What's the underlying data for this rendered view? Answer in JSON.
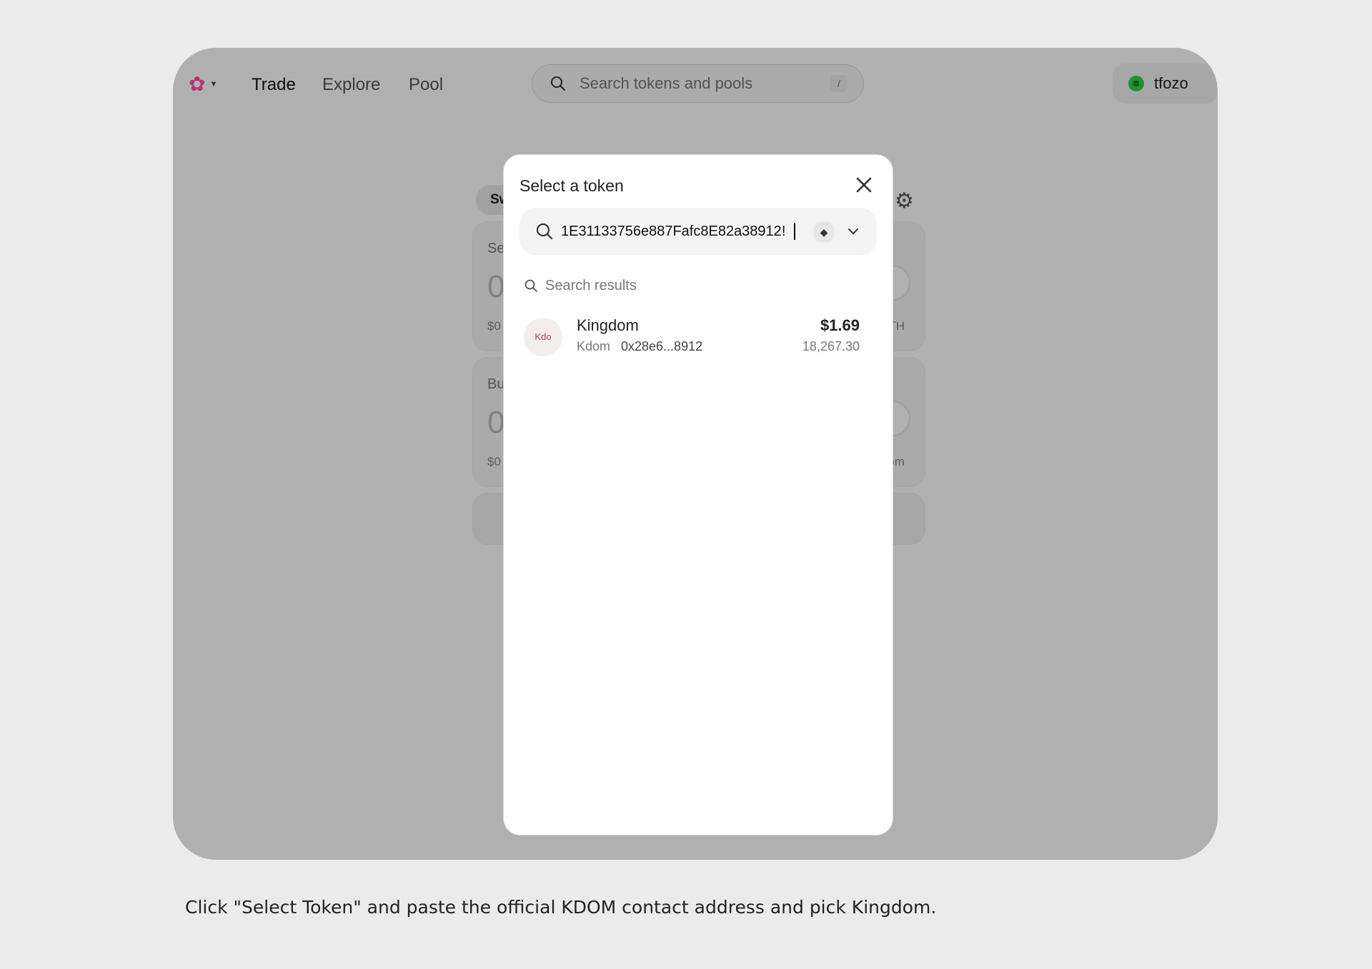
{
  "nav": {
    "trade": "Trade",
    "explore": "Explore",
    "pool": "Pool",
    "search_placeholder": "Search tokens and pools",
    "search_shortcut": "/",
    "account_name": "tfozo"
  },
  "swap": {
    "tab_label": "Sw",
    "sell_label": "Se",
    "sell_amount": "0",
    "sell_usd": "$0",
    "sell_right": "TH",
    "buy_label": "Bu",
    "buy_amount": "0",
    "buy_usd": "$0",
    "buy_right": "om"
  },
  "modal": {
    "title": "Select a token",
    "search_value": "!1E31133756e887Fafc8E82a38912",
    "chain_icon": "ethereum-icon",
    "results_header": "Search results",
    "results": [
      {
        "logo_text": "Kdo",
        "name": "Kingdom",
        "symbol": "Kdom",
        "address": "0x28e6...8912",
        "price": "$1.69",
        "balance": "18,267.30"
      }
    ]
  },
  "caption": "Click \"Select Token\" and paste the official KDOM contact address and pick Kingdom.",
  "colors": {
    "overlay": "#00000050",
    "brand_pink": "#ff4fa8",
    "account_green": "#30d34f"
  }
}
